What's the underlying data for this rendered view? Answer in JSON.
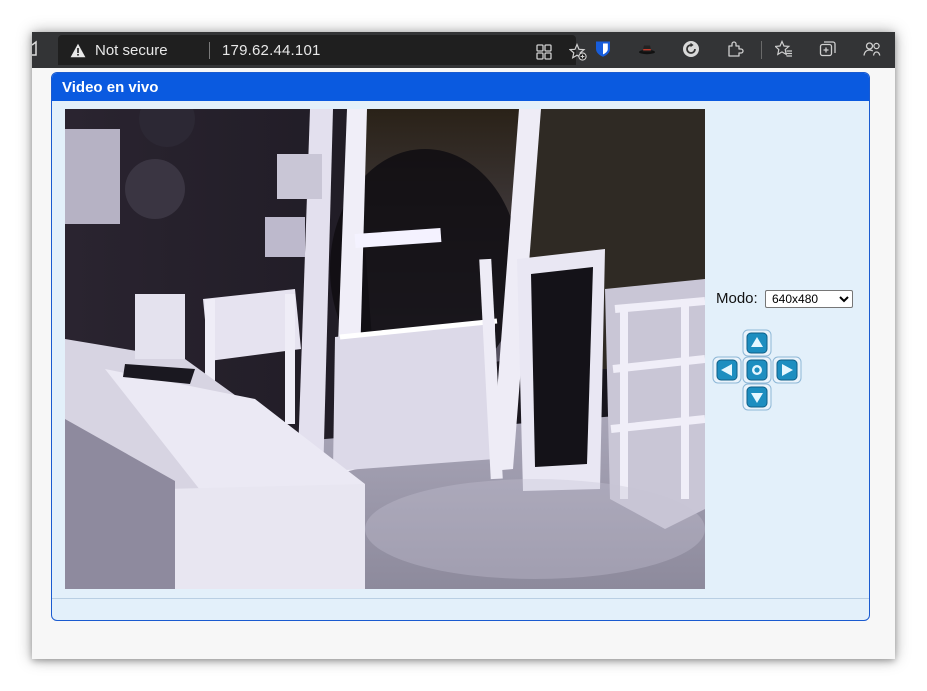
{
  "browser": {
    "security_label": "Not secure",
    "url": "179.62.44.101"
  },
  "panel": {
    "title": "Video en vivo"
  },
  "controls": {
    "mode_label": "Modo:",
    "mode_selected": "640x480"
  },
  "icons": {
    "toolbar": [
      "home-icon",
      "warning-icon",
      "app-grid-icon",
      "add-favorite-icon",
      "bitwarden-icon",
      "hat-extension-icon",
      "refresh-extension-icon",
      "extensions-icon",
      "favorites-icon",
      "collections-icon",
      "profile-icon"
    ],
    "ptz": [
      "arrow-up-icon",
      "arrow-left-icon",
      "center-icon",
      "arrow-right-icon",
      "arrow-down-icon"
    ]
  },
  "colors": {
    "panel_header": "#0a5ae0",
    "panel_background": "#e3f0fa",
    "dpad_button": "#1d8ec0"
  }
}
